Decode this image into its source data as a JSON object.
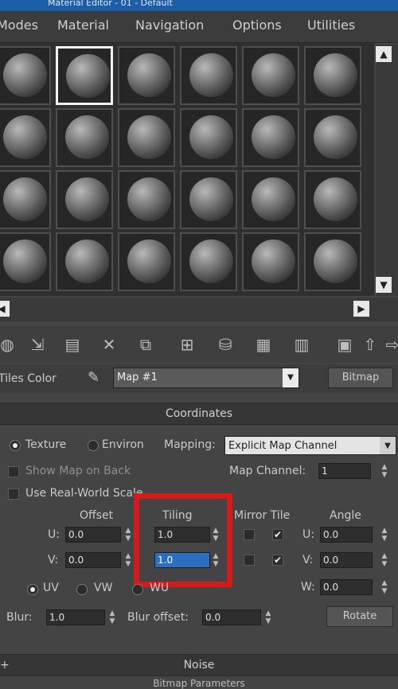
{
  "window": {
    "title": "Material Editor - 01 - Default"
  },
  "menu": [
    "Modes",
    "Material",
    "Navigation",
    "Options",
    "Utilities"
  ],
  "slots": {
    "rows": 4,
    "cols": 6,
    "active_index": 1
  },
  "toolbar": {
    "icons": [
      "sphere-icon",
      "put-material-icon",
      "assign-icon",
      "delete-icon",
      "copy-icon",
      "unique-icon",
      "put-library-icon",
      "material-id-icon",
      "show-map-icon",
      "show-end-result-icon",
      "go-parent-icon",
      "go-sibling-icon"
    ]
  },
  "material_name": {
    "label": "Tiles Color",
    "value": "Map #1",
    "type_button": "Bitmap"
  },
  "coordinates": {
    "header": "Coordinates",
    "mode_texture": "Texture",
    "mode_environ": "Environ",
    "mapping_label": "Mapping:",
    "mapping_value": "Explicit Map Channel",
    "show_map_on_back": "Show Map on Back",
    "map_channel_label": "Map Channel:",
    "map_channel_value": "1",
    "real_world": "Use Real-World Scale",
    "offset_header": "Offset",
    "tiling_header": "Tiling",
    "mirror_tile_header": "Mirror Tile",
    "angle_header": "Angle",
    "u_label": "U:",
    "v_label": "V:",
    "w_label": "W:",
    "offset_u": "0.0",
    "offset_v": "0.0",
    "tiling_u": "1.0",
    "tiling_v": "1.0",
    "angle_u": "0.0",
    "angle_v": "0.0",
    "angle_w": "0.0",
    "uv": "UV",
    "vw": "VW",
    "wu": "WU",
    "blur_label": "Blur:",
    "blur_value": "1.0",
    "blur_offset_label": "Blur offset:",
    "blur_offset_value": "0.0",
    "rotate_button": "Rotate"
  },
  "noise": {
    "header": "Noise",
    "next_header": "Bitmap Parameters"
  },
  "colors": {
    "highlight": "#d61a1a",
    "selection": "#2d6fbf"
  }
}
